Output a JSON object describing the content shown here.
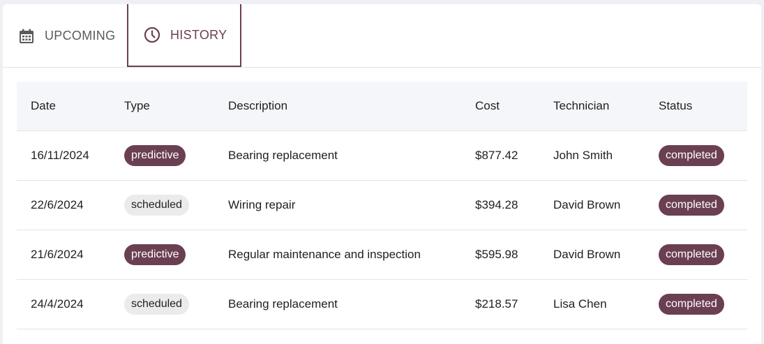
{
  "colors": {
    "accent": "#6b3f52",
    "chip_neutral": "#ebebeb",
    "header_bg": "#f5f6fa"
  },
  "tabs": [
    {
      "label": "UPCOMING",
      "icon": "calendar-icon",
      "active": false
    },
    {
      "label": "HISTORY",
      "icon": "clock-icon",
      "active": true
    }
  ],
  "table": {
    "headers": [
      "Date",
      "Type",
      "Description",
      "Cost",
      "Technician",
      "Status"
    ],
    "rows": [
      {
        "date": "16/11/2024",
        "type": "predictive",
        "description": "Bearing replacement",
        "cost": "$877.42",
        "technician": "John Smith",
        "status": "completed"
      },
      {
        "date": "22/6/2024",
        "type": "scheduled",
        "description": "Wiring repair",
        "cost": "$394.28",
        "technician": "David Brown",
        "status": "completed"
      },
      {
        "date": "21/6/2024",
        "type": "predictive",
        "description": "Regular maintenance and inspection",
        "cost": "$595.98",
        "technician": "David Brown",
        "status": "completed"
      },
      {
        "date": "24/4/2024",
        "type": "scheduled",
        "description": "Bearing replacement",
        "cost": "$218.57",
        "technician": "Lisa Chen",
        "status": "completed"
      }
    ]
  }
}
